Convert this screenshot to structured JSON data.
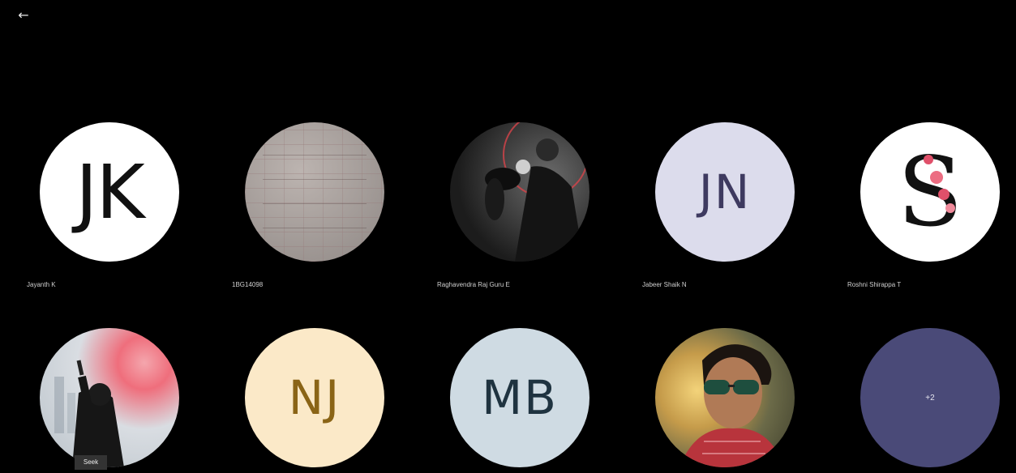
{
  "header": {
    "back_icon": "arrow-left-icon",
    "back_glyph": "←"
  },
  "participants": [
    {
      "name": "Jayanth K",
      "initials": "JK",
      "avatar_type": "initials",
      "bg": "#ffffff",
      "fg": "#111111"
    },
    {
      "name": "1BG14098",
      "avatar_type": "photo",
      "photo": "notebook-photo"
    },
    {
      "name": "Raghavendra Raj Guru E",
      "avatar_type": "photo",
      "photo": "person-with-dog-photo"
    },
    {
      "name": "Jabeer Shaik N",
      "initials": "JN",
      "avatar_type": "initials",
      "bg": "#dcdcec",
      "fg": "#3e3a60"
    },
    {
      "name": "Roshni Shirappa T",
      "avatar_type": "logo",
      "logo": "letter-s-floral-logo",
      "logo_letter": "S"
    },
    {
      "name": "",
      "avatar_type": "photo",
      "photo": "smoke-flare-photo",
      "tag": "Seek"
    },
    {
      "name": "",
      "initials": "NJ",
      "avatar_type": "initials",
      "bg": "#fbe9c8",
      "fg": "#8a6416"
    },
    {
      "name": "",
      "initials": "MB",
      "avatar_type": "initials",
      "bg": "#cfdbe3",
      "fg": "#1f3340"
    },
    {
      "name": "",
      "avatar_type": "photo",
      "photo": "man-sunglasses-photo"
    },
    {
      "name": "",
      "overflow_count": "+2",
      "avatar_type": "overflow",
      "bg": "#4a4a78"
    }
  ]
}
